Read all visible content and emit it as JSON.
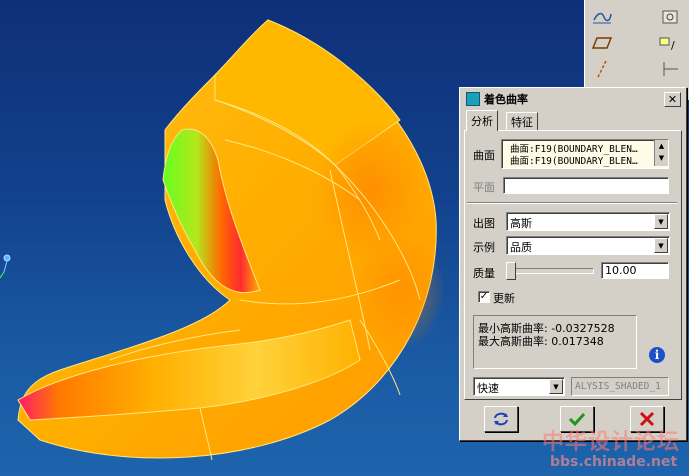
{
  "dialog": {
    "title": "着色曲率",
    "close_icon": "close-icon",
    "tabs": [
      {
        "label": "分析",
        "active": true
      },
      {
        "label": "特征",
        "active": false
      }
    ],
    "surface_label": "曲面",
    "surface_items": [
      "曲面:F19(BOUNDARY_BLEN…",
      "曲面:F19(BOUNDARY_BLEN…"
    ],
    "plane_label": "平面",
    "plane_value": "",
    "output_label": "出图",
    "output_value": "高斯",
    "example_label": "示例",
    "example_value": "品质",
    "quality_label": "质量",
    "quality_value": "10.00",
    "quality_fraction": 0.0,
    "update_label": "更新",
    "update_checked": true,
    "result_line1": "最小高斯曲率: -0.0327528",
    "result_line2": "最大高斯曲率: 0.017348",
    "speed_value": "快速",
    "name_value": "ALYSIS_SHADED_1",
    "buttons": {
      "repeat": "repeat-icon",
      "ok": "check-icon",
      "cancel": "x-icon"
    }
  },
  "watermark": {
    "line1": "中华设计论坛",
    "line2": "bbs.chinade.net"
  },
  "colors": {
    "viewport_top": "#0f2f78",
    "viewport_bottom": "#1d64ad",
    "surface_base": "#ffb000",
    "highlight_green": "#5be61a",
    "highlight_red": "#ff1a5a",
    "dialog_bg": "#d4d0c8"
  }
}
